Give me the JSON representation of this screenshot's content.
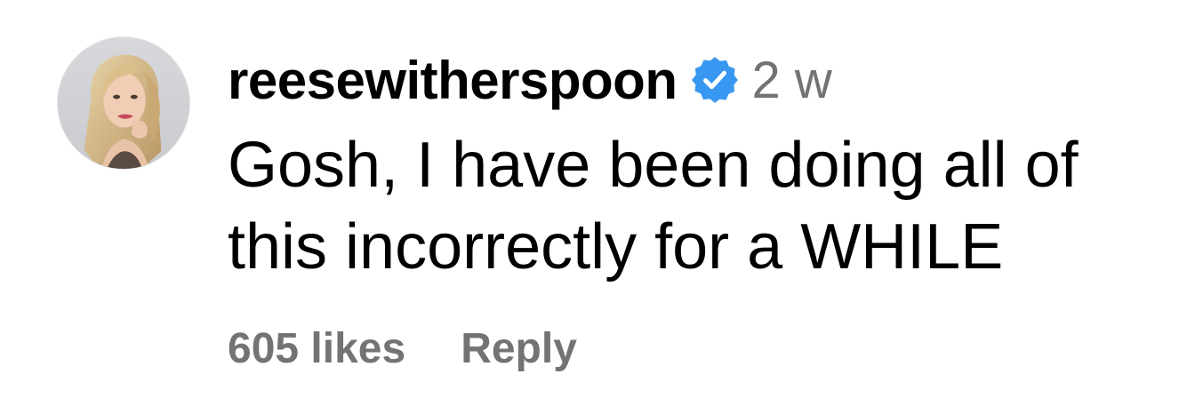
{
  "comment": {
    "avatar_icon": "avatar",
    "username": "reesewitherspoon",
    "verified_icon": "verified-badge-icon",
    "verified_color": "#3897F0",
    "timestamp": "2 w",
    "text_lines": [
      "Gosh, I have been doing all of",
      "this incorrectly for a WHILE"
    ],
    "likes_label": "605 likes",
    "reply_label": "Reply"
  }
}
